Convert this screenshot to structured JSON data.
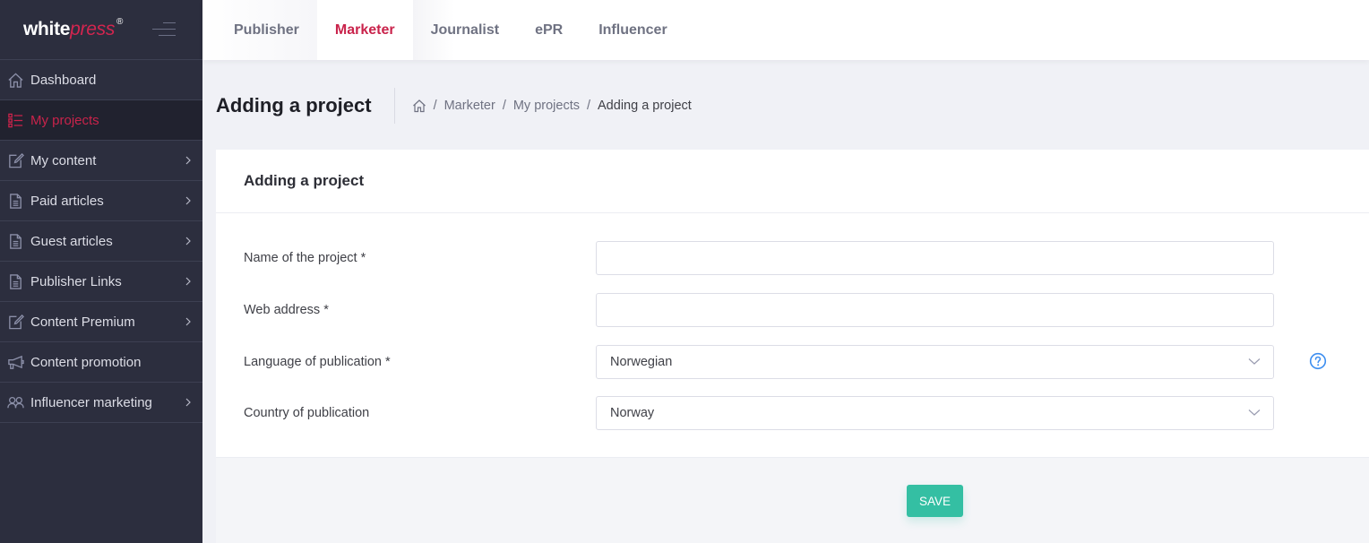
{
  "brand": {
    "logo_part1": "white",
    "logo_part2": "press",
    "logo_mark": "®"
  },
  "sidebar": {
    "items": [
      {
        "label": "Dashboard",
        "icon": "home-icon",
        "active": false,
        "has_submenu": false
      },
      {
        "label": "My projects",
        "icon": "list-icon",
        "active": true,
        "has_submenu": false
      },
      {
        "label": "My content",
        "icon": "edit-icon",
        "active": false,
        "has_submenu": true
      },
      {
        "label": "Paid articles",
        "icon": "document-icon",
        "active": false,
        "has_submenu": true
      },
      {
        "label": "Guest articles",
        "icon": "document-icon",
        "active": false,
        "has_submenu": true
      },
      {
        "label": "Publisher Links",
        "icon": "document-icon",
        "active": false,
        "has_submenu": true
      },
      {
        "label": "Content Premium",
        "icon": "edit-icon",
        "active": false,
        "has_submenu": true
      },
      {
        "label": "Content promotion",
        "icon": "megaphone-icon",
        "active": false,
        "has_submenu": false
      },
      {
        "label": "Influencer marketing",
        "icon": "users-icon",
        "active": false,
        "has_submenu": true
      }
    ]
  },
  "topbar": {
    "tabs": [
      {
        "label": "Publisher",
        "active": false
      },
      {
        "label": "Marketer",
        "active": true
      },
      {
        "label": "Journalist",
        "active": false
      },
      {
        "label": "ePR",
        "active": false
      },
      {
        "label": "Influencer",
        "active": false
      }
    ]
  },
  "subheader": {
    "title": "Adding a project",
    "breadcrumb": {
      "separator": "/",
      "items": [
        "Marketer",
        "My projects",
        "Adding a project"
      ]
    }
  },
  "card": {
    "title": "Adding a project",
    "fields": [
      {
        "label": "Name of the project *",
        "type": "text",
        "value": "",
        "placeholder": ""
      },
      {
        "label": "Web address *",
        "type": "text",
        "value": "",
        "placeholder": ""
      },
      {
        "label": "Language of publication *",
        "type": "select",
        "value": "Norwegian",
        "help": true
      },
      {
        "label": "Country of publication",
        "type": "select",
        "value": "Norway"
      }
    ],
    "save_label": "SAVE"
  },
  "colors": {
    "sidebar_bg": "#2c2e3e",
    "accent": "#c9234b",
    "save": "#34bfa3",
    "help": "#3d8ef0"
  }
}
